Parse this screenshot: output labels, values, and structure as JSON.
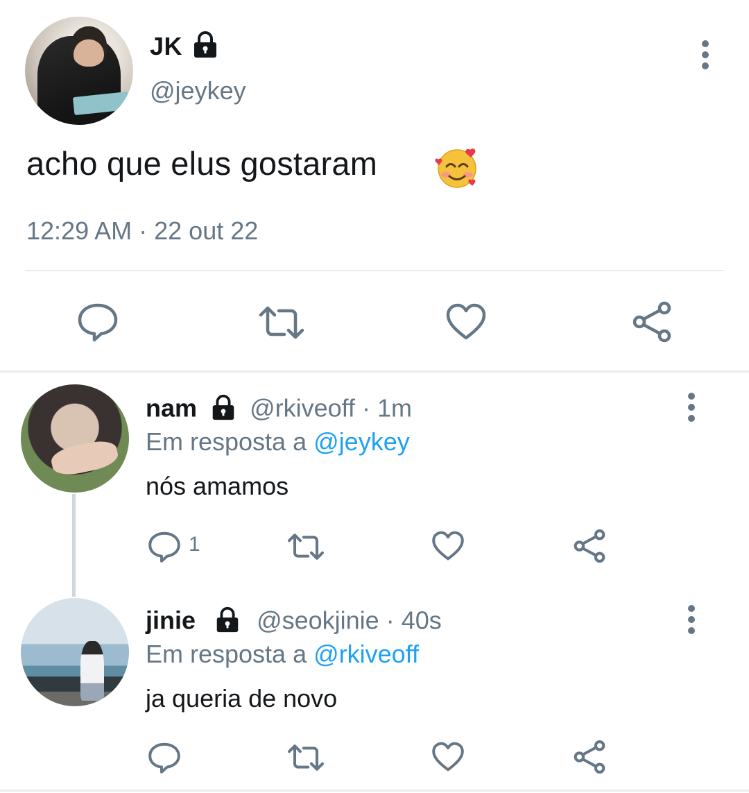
{
  "main_tweet": {
    "name": "JK",
    "handle": "@jeykey",
    "text": "acho que elus gostaram",
    "emoji": "smiling-face-with-hearts",
    "time": "12:29 AM",
    "separator": "·",
    "date": "22 out 22",
    "actions": [
      "reply-icon",
      "retweet-icon",
      "like-icon",
      "share-icon"
    ]
  },
  "replies": [
    {
      "name": "nam",
      "handle": "@rkiveoff",
      "age": "1m",
      "reply_prefix": "Em resposta a",
      "reply_to": "@jeykey",
      "text": "nós amamos",
      "reply_count": "1"
    },
    {
      "name": "jinie",
      "handle": "@seokjinie",
      "age": "40s",
      "reply_prefix": "Em resposta a",
      "reply_to": "@rkiveoff",
      "text": "ja queria de novo"
    }
  ],
  "colors": {
    "text": "#14171a",
    "muted": "#657786",
    "link": "#1da1f2",
    "divider": "#e6ecf0"
  }
}
